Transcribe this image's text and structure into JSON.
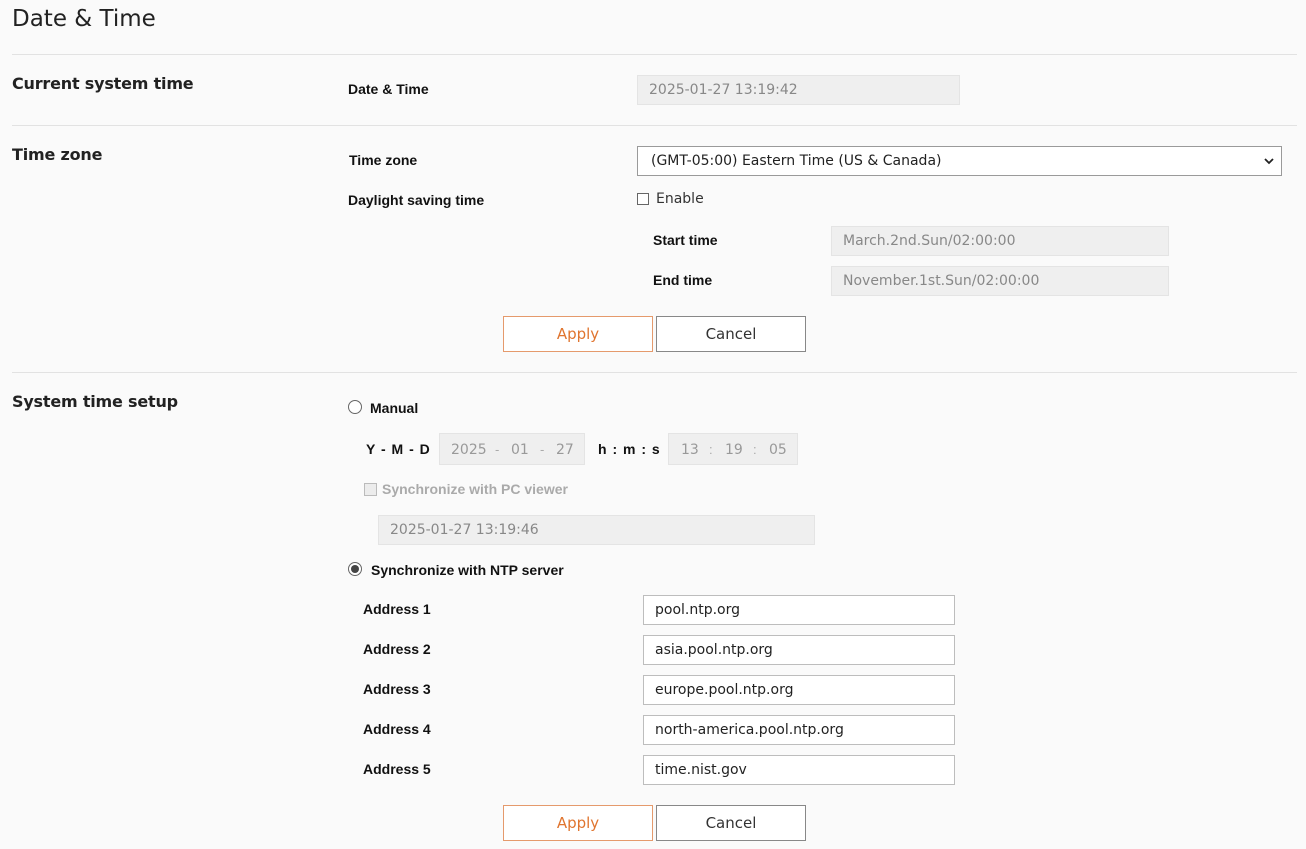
{
  "page": {
    "title": "Date & Time"
  },
  "current_system_time": {
    "section_label": "Current system time",
    "date_time_label": "Date & Time",
    "date_time_value": "2025-01-27 13:19:42"
  },
  "time_zone": {
    "section_label": "Time zone",
    "timezone_label": "Time zone",
    "timezone_selected": "(GMT-05:00) Eastern Time (US & Canada)",
    "dst_label": "Daylight saving time",
    "dst_enable_label": "Enable",
    "dst_enabled": false,
    "start_time_label": "Start time",
    "start_time_value": "March.2nd.Sun/02:00:00",
    "end_time_label": "End time",
    "end_time_value": "November.1st.Sun/02:00:00",
    "apply_label": "Apply",
    "cancel_label": "Cancel"
  },
  "system_time_setup": {
    "section_label": "System time setup",
    "manual_label": "Manual",
    "manual_selected": false,
    "ymd_label": "Y - M - D",
    "year": "2025",
    "month": "01",
    "day": "27",
    "date_sep": "-",
    "hms_label": "h : m : s",
    "hour": "13",
    "minute": "19",
    "second": "05",
    "time_sep": ":",
    "sync_pc_label": "Synchronize with PC viewer",
    "pc_time_value": "2025-01-27 13:19:46",
    "ntp_label": "Synchronize with NTP server",
    "ntp_selected": true,
    "addresses": [
      {
        "label": "Address 1",
        "value": "pool.ntp.org"
      },
      {
        "label": "Address 2",
        "value": "asia.pool.ntp.org"
      },
      {
        "label": "Address 3",
        "value": "europe.pool.ntp.org"
      },
      {
        "label": "Address 4",
        "value": "north-america.pool.ntp.org"
      },
      {
        "label": "Address 5",
        "value": "time.nist.gov"
      }
    ],
    "apply_label": "Apply",
    "cancel_label": "Cancel"
  },
  "colors": {
    "apply_accent": "#e0752f",
    "background": "#fafafa",
    "disabled_field": "#efefef"
  }
}
